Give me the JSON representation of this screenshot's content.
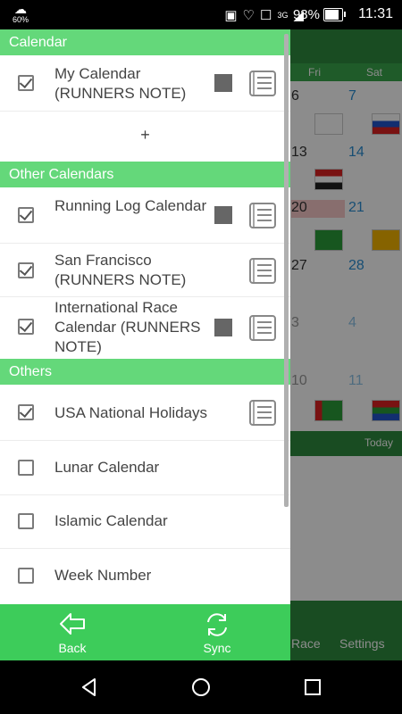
{
  "status_bar": {
    "weather_percent": "60%",
    "network": "3G",
    "battery": "98%",
    "battery_level": 0.98,
    "time": "11:31"
  },
  "background": {
    "weekdays": [
      "Fri",
      "Sat"
    ],
    "dates": [
      "6",
      "7",
      "13",
      "14",
      "20",
      "21",
      "27",
      "28",
      "3",
      "4",
      "10",
      "11"
    ],
    "today_label": "Today",
    "bottom_tabs": [
      "Race",
      "Settings"
    ]
  },
  "sections": {
    "calendar": "Calendar",
    "other_calendars": "Other Calendars",
    "others": "Others"
  },
  "items": {
    "my_calendar": {
      "label": "My Calendar (RUNNERS NOTE)",
      "checked": true
    },
    "add": "+",
    "running_log": {
      "label": "Running Log Calendar",
      "checked": true
    },
    "san_francisco": {
      "label": "San Francisco (RUNNERS NOTE)",
      "checked": true
    },
    "international_race": {
      "label": "International Race Calendar (RUNNERS NOTE)",
      "checked": true
    },
    "usa_holidays": {
      "label": "USA National Holidays",
      "checked": true
    },
    "lunar": {
      "label": "Lunar Calendar",
      "checked": false
    },
    "islamic": {
      "label": "Islamic Calendar",
      "checked": false
    },
    "week_number": {
      "label": "Week Number",
      "checked": false
    }
  },
  "footer": {
    "back_label": "Back",
    "sync_label": "Sync"
  },
  "colors": {
    "section_header": "#64d87a",
    "footer": "#3dcc5a",
    "calendar_color": "#666666"
  }
}
